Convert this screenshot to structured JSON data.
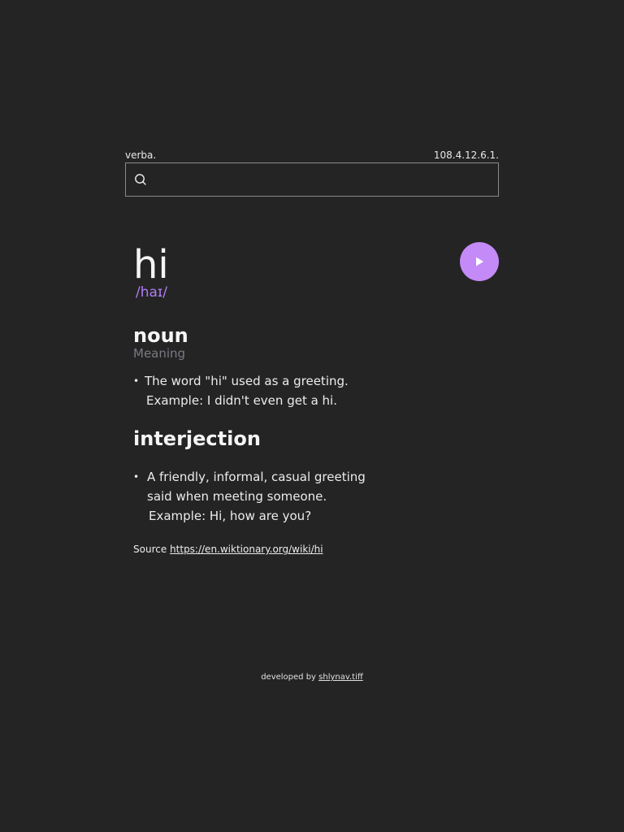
{
  "app": {
    "brand": "verba.",
    "version": "108.4.12.6.1."
  },
  "search": {
    "value": "",
    "placeholder": "",
    "icon": "search-icon"
  },
  "entry": {
    "word": "hi",
    "phonetic": "/haɪ/",
    "play_icon": "play-icon",
    "accent_color": "#c48af7",
    "meanings": [
      {
        "part_of_speech": "noun",
        "label": "Meaning",
        "definitions": [
          {
            "text": "The word \"hi\" used as a greeting.",
            "example": "Example: I didn't even get a hi."
          }
        ]
      },
      {
        "part_of_speech": "interjection",
        "definitions": [
          {
            "text": "A friendly, informal, casual greeting said when meeting someone.",
            "example": "Example: Hi, how are you?"
          }
        ]
      }
    ],
    "source_label": "Source",
    "source_url": "https://en.wiktionary.org/wiki/hi"
  },
  "footer": {
    "prefix": "developed by",
    "author": "shlynav.tiff"
  }
}
